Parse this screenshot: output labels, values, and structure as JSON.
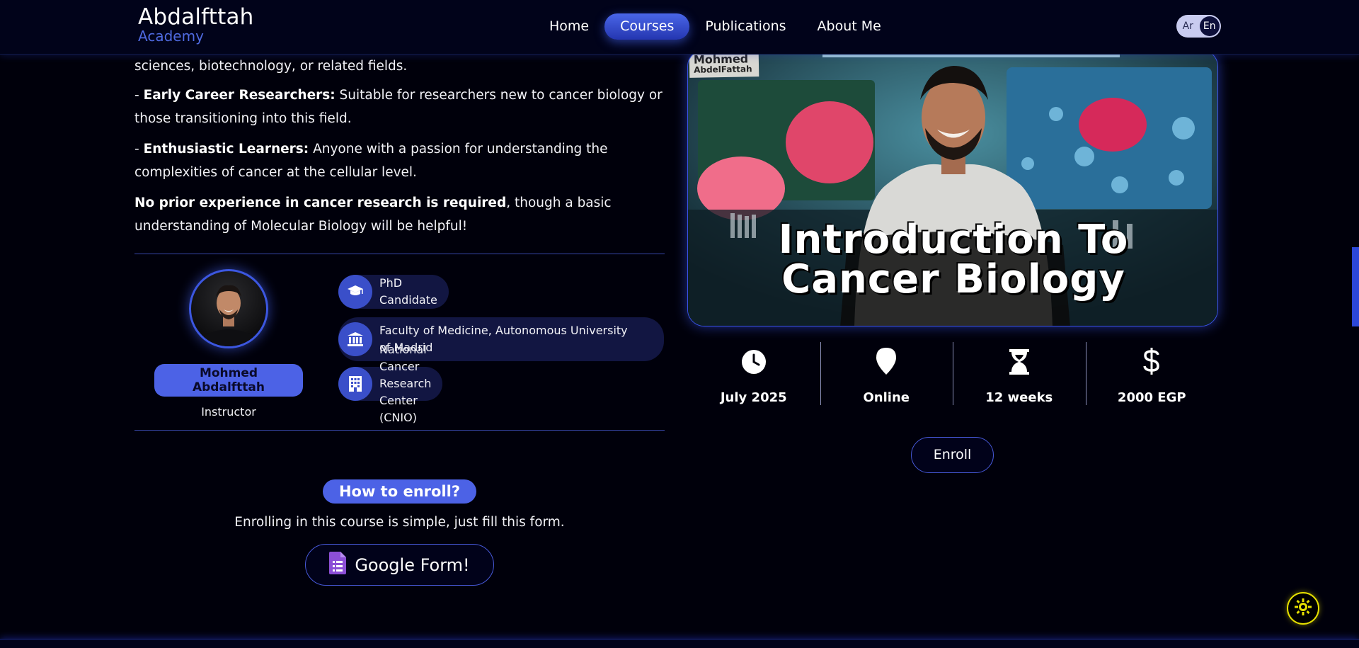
{
  "header": {
    "logo_title": "Abdalfttah",
    "logo_subtitle": "Academy",
    "nav": [
      {
        "label": "Home",
        "active": false
      },
      {
        "label": "Courses",
        "active": true
      },
      {
        "label": "Publications",
        "active": false
      },
      {
        "label": "About Me",
        "active": false
      }
    ],
    "lang": {
      "ar": "Ar",
      "en": "En",
      "selected": "En"
    }
  },
  "audience": {
    "line_intro": "sciences, biotechnology, or related fields.",
    "early_prefix": "- ",
    "early_title": "Early Career Researchers:",
    "early_text": " Suitable for researchers new to cancer biology or those transitioning into this field.",
    "learners_prefix": "- ",
    "learners_title": "Enthusiastic Learners:",
    "learners_text": " Anyone with a passion for understanding the complexities of cancer at the cellular level.",
    "requirement_bold": "No prior experience in cancer research is required",
    "requirement_text": ", though a basic understanding of Molecular Biology will be helpful!"
  },
  "instructor": {
    "name": "Mohmed Abdalfttah",
    "role": "Instructor",
    "credentials": [
      {
        "icon": "graduation-cap-icon",
        "text": "PhD Candidate"
      },
      {
        "icon": "university-icon",
        "text": "Faculty of Medicine, Autonomous University of Madrid"
      },
      {
        "icon": "building-icon",
        "text": "National Cancer Research Center (CNIO)"
      }
    ]
  },
  "enroll_info": {
    "heading": "How to enroll?",
    "text": "Enrolling in this course is simple, just fill this form.",
    "form_button": "Google Form!"
  },
  "course": {
    "banner_signature_line1": "Mohmed",
    "banner_signature_line2": "AbdelFattah",
    "banner_title_line1": "Introduction To",
    "banner_title_line2": "Cancer Biology",
    "stats": [
      {
        "icon": "clock-icon",
        "value": "July 2025"
      },
      {
        "icon": "location-pin-icon",
        "value": "Online"
      },
      {
        "icon": "hourglass-icon",
        "value": "12 weeks"
      },
      {
        "icon": "dollar-icon",
        "value": "2000 EGP"
      }
    ],
    "enroll_button": "Enroll"
  },
  "colors": {
    "background": "#00000b",
    "accent": "#4c62e6",
    "header_bg": "#01031a",
    "theme_toggle": "#e6e000"
  }
}
